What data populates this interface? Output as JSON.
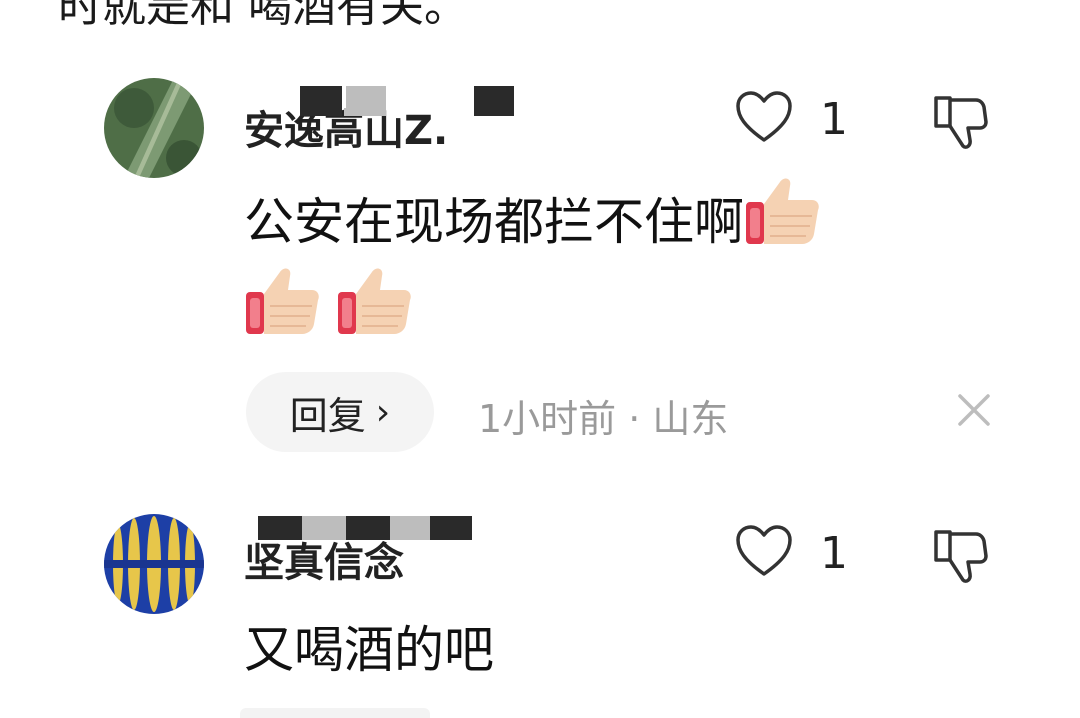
{
  "top_text": "时就是和 喝酒有关。",
  "comments": [
    {
      "username": "安逸高山Z.",
      "likes": "1",
      "text_line1": "公安在现场都拦不住啊",
      "reply_label": "回复",
      "reply_chevron": "›",
      "meta": "1小时前 · 山东",
      "emoji_name": "thumbs-up-emoji",
      "emoji_count": 3
    },
    {
      "username": "坚真信念",
      "likes": "1",
      "text_line1": "又喝酒的吧"
    }
  ],
  "icons": {
    "like": "heart-outline-icon",
    "dislike": "thumbs-down-outline-icon",
    "close": "close-icon"
  }
}
